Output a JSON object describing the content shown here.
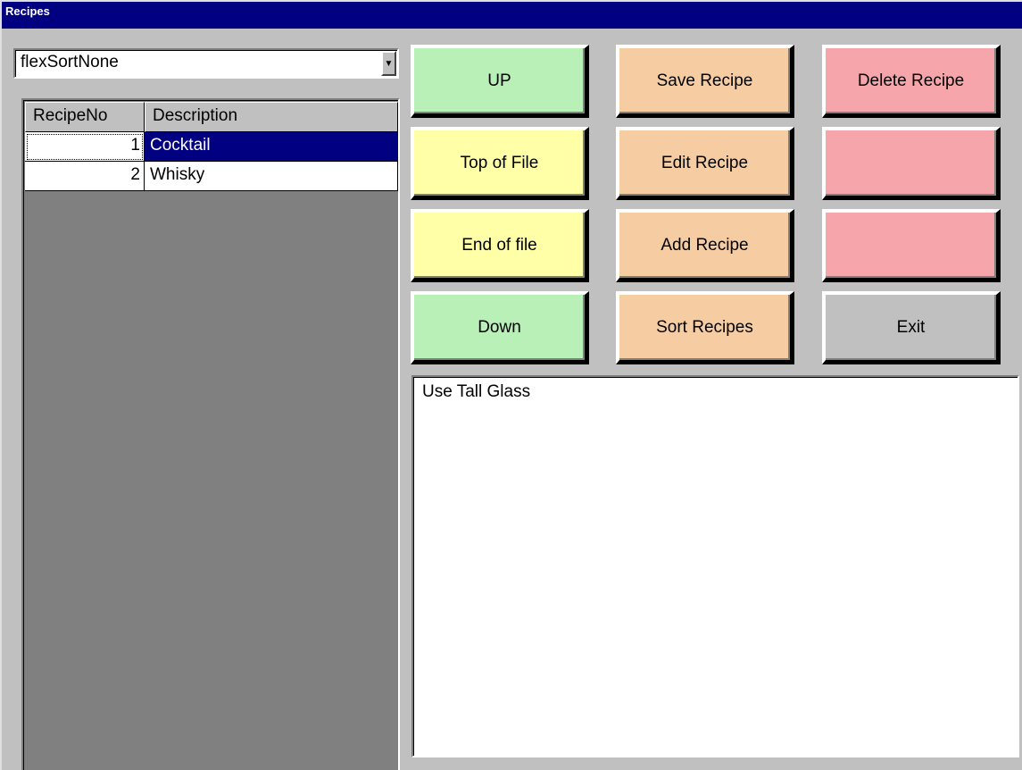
{
  "window": {
    "title": "Recipes"
  },
  "sort_combo": {
    "value": "flexSortNone"
  },
  "grid": {
    "headers": [
      "RecipeNo",
      "Description"
    ],
    "rows": [
      {
        "no": "1",
        "description": "Cocktail",
        "selected": true
      },
      {
        "no": "2",
        "description": "Whisky",
        "selected": false
      }
    ]
  },
  "buttons": {
    "up": "UP",
    "top_of_file": "Top of File",
    "end_of_file": "End of file",
    "down": "Down",
    "save_recipe": "Save Recipe",
    "edit_recipe": "Edit Recipe",
    "add_recipe": "Add Recipe",
    "sort_recipes": "Sort Recipes",
    "delete_recipe": "Delete Recipe",
    "blank1": "",
    "blank2": "",
    "exit": "Exit"
  },
  "memo": {
    "text": "Use Tall Glass"
  },
  "colors": {
    "titlebar": "#000080",
    "green": "#b8f0b8",
    "yellow": "#ffffa8",
    "peach": "#f6cda3",
    "pink": "#f6a6ab",
    "selection": "#000080"
  }
}
